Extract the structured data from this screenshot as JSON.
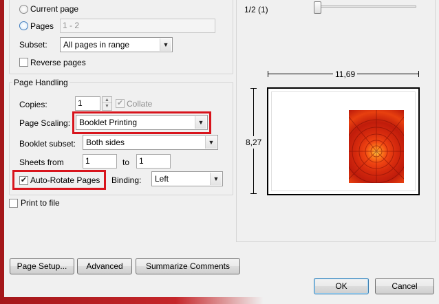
{
  "range": {
    "current_page_label": "Current page",
    "pages_label": "Pages",
    "pages_value": "1 - 2",
    "subset_label": "Subset:",
    "subset_value": "All pages in range",
    "reverse_label": "Reverse pages"
  },
  "handling": {
    "title": "Page Handling",
    "copies_label": "Copies:",
    "copies_value": "1",
    "collate_label": "Collate",
    "scaling_label": "Page Scaling:",
    "scaling_value": "Booklet Printing",
    "booklet_subset_label": "Booklet subset:",
    "booklet_subset_value": "Both sides",
    "sheets_from_label": "Sheets from",
    "sheets_from_value": "1",
    "sheets_to_label": "to",
    "sheets_to_value": "1",
    "auto_rotate_label": "Auto-Rotate Pages",
    "binding_label": "Binding:",
    "binding_value": "Left"
  },
  "print_to_file_label": "Print to file",
  "buttons": {
    "page_setup": "Page Setup...",
    "advanced": "Advanced",
    "summarize": "Summarize Comments",
    "ok": "OK",
    "cancel": "Cancel"
  },
  "preview": {
    "page_indicator": "1/2 (1)",
    "width_label": "11,69",
    "height_label": "8,27"
  },
  "colors": {
    "highlight": "#d8141c",
    "frame_red": "#a4171a"
  },
  "icons": {
    "checked": "✔",
    "dropdown": "▼",
    "spin_up": "▲",
    "spin_down": "▼"
  }
}
